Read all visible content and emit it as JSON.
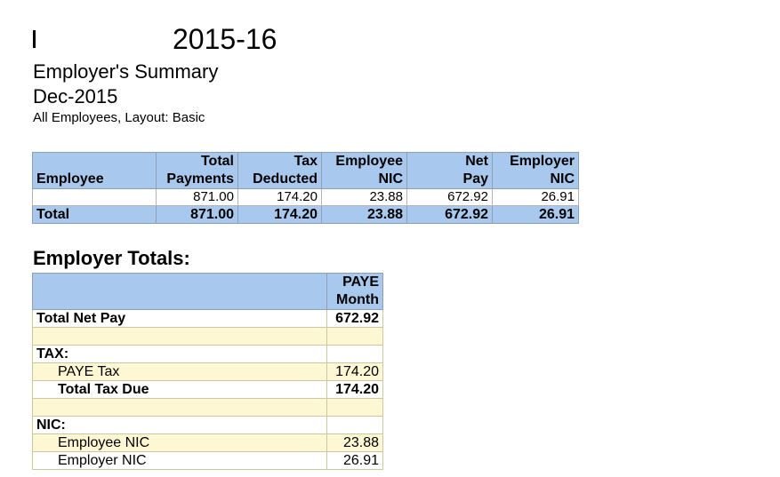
{
  "header": {
    "year": "2015-16",
    "report_title": "Employer's Summary",
    "period": "Dec-2015",
    "filter": "All Employees, Layout: Basic"
  },
  "summary_table": {
    "columns": [
      {
        "line1": "",
        "line2": "Employee"
      },
      {
        "line1": "Total",
        "line2": "Payments"
      },
      {
        "line1": "Tax",
        "line2": "Deducted"
      },
      {
        "line1": "Employee",
        "line2": "NIC"
      },
      {
        "line1": "Net",
        "line2": "Pay"
      },
      {
        "line1": "Employer",
        "line2": "NIC"
      }
    ],
    "rows": [
      {
        "employee": "",
        "total_payments": "871.00",
        "tax_deducted": "174.20",
        "employee_nic": "23.88",
        "net_pay": "672.92",
        "employer_nic": "26.91"
      }
    ],
    "total": {
      "label": "Total",
      "total_payments": "871.00",
      "tax_deducted": "174.20",
      "employee_nic": "23.88",
      "net_pay": "672.92",
      "employer_nic": "26.91"
    }
  },
  "employer_totals": {
    "title": "Employer Totals:",
    "col_header_line1": "PAYE",
    "col_header_line2": "Month",
    "rows": [
      {
        "label": "Total Net Pay",
        "value": "672.92"
      },
      {
        "label": "",
        "value": ""
      },
      {
        "label": "TAX:",
        "value": ""
      },
      {
        "label": "PAYE Tax",
        "value": "174.20"
      },
      {
        "label": "Total Tax Due",
        "value": "174.20"
      },
      {
        "label": "",
        "value": ""
      },
      {
        "label": "NIC:",
        "value": ""
      },
      {
        "label": "Employee NIC",
        "value": "23.88"
      },
      {
        "label": "Employer NIC",
        "value": "26.91"
      }
    ]
  }
}
